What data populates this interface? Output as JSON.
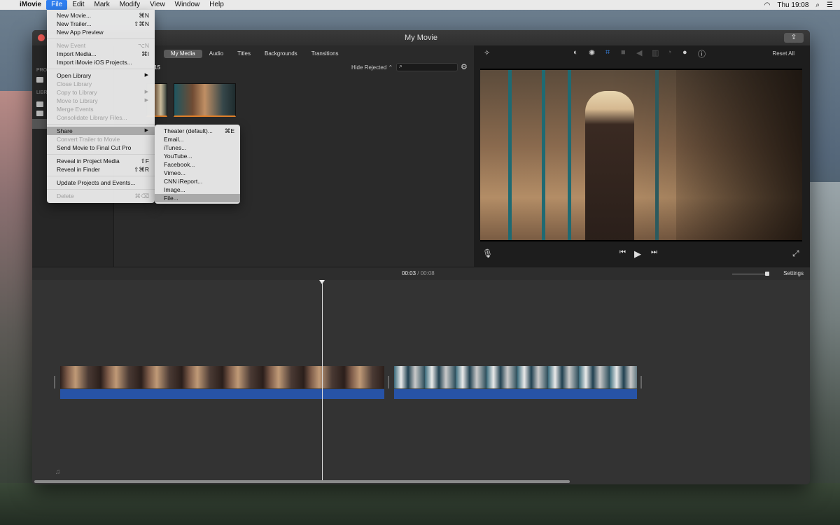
{
  "menubar": {
    "apple": "",
    "app": "iMovie",
    "items": [
      "File",
      "Edit",
      "Mark",
      "Modify",
      "View",
      "Window",
      "Help"
    ],
    "clock": "Thu 19:08"
  },
  "window": {
    "title": "My Movie",
    "share_icon": "share-icon"
  },
  "sidebar": {
    "projects_label": "PRO",
    "libraries_label": "LIBR"
  },
  "browser": {
    "tabs": [
      "My Media",
      "Audio",
      "Titles",
      "Backgrounds",
      "Transitions"
    ],
    "active_tab": "My Media",
    "count_fragment": "15",
    "hide_rejected": "Hide Rejected",
    "search_placeholder": ""
  },
  "viewer": {
    "reset_all": "Reset All",
    "tools": [
      "magic-wand-icon",
      "color-balance-icon",
      "color-correction-icon",
      "crop-icon",
      "stabilization-icon",
      "volume-icon",
      "equalizer-icon",
      "speed-icon",
      "filter-icon",
      "info-icon"
    ]
  },
  "timeline": {
    "current_time": "00:03",
    "separator": "/",
    "total_time": "00:08",
    "settings": "Settings",
    "playhead_progress": 0.38,
    "zoom_level": 0.95
  },
  "file_menu": {
    "items": [
      {
        "label": "New Movie...",
        "shortcut": "⌘N",
        "enabled": true
      },
      {
        "label": "New Trailer...",
        "shortcut": "⇧⌘N",
        "enabled": true
      },
      {
        "label": "New App Preview",
        "shortcut": "",
        "enabled": true
      },
      {
        "label": "New Event",
        "shortcut": "⌥N",
        "enabled": false
      },
      {
        "label": "Import Media...",
        "shortcut": "⌘I",
        "enabled": true
      },
      {
        "label": "Import iMovie iOS Projects...",
        "shortcut": "",
        "enabled": true
      },
      {
        "label": "Open Library",
        "shortcut": "",
        "enabled": true,
        "submenu": true
      },
      {
        "label": "Close Library",
        "shortcut": "",
        "enabled": false
      },
      {
        "label": "Copy to Library",
        "shortcut": "",
        "enabled": false,
        "submenu": true
      },
      {
        "label": "Move to Library",
        "shortcut": "",
        "enabled": false,
        "submenu": true
      },
      {
        "label": "Merge Events",
        "shortcut": "",
        "enabled": false
      },
      {
        "label": "Consolidate Library Files...",
        "shortcut": "",
        "enabled": false
      },
      {
        "label": "Share",
        "shortcut": "",
        "enabled": true,
        "submenu": true,
        "highlighted": true
      },
      {
        "label": "Convert Trailer to Movie",
        "shortcut": "",
        "enabled": false
      },
      {
        "label": "Send Movie to Final Cut Pro",
        "shortcut": "",
        "enabled": true
      },
      {
        "label": "Reveal in Project Media",
        "shortcut": "⇧F",
        "enabled": true
      },
      {
        "label": "Reveal in Finder",
        "shortcut": "⇧⌘R",
        "enabled": true
      },
      {
        "label": "Update Projects and Events...",
        "shortcut": "",
        "enabled": true
      },
      {
        "label": "Delete",
        "shortcut": "⌘⌫",
        "enabled": false
      }
    ]
  },
  "share_menu": {
    "items": [
      {
        "label": "Theater (default)...",
        "shortcut": "⌘E"
      },
      {
        "label": "Email...",
        "shortcut": ""
      },
      {
        "label": "iTunes...",
        "shortcut": ""
      },
      {
        "label": "YouTube...",
        "shortcut": ""
      },
      {
        "label": "Facebook...",
        "shortcut": ""
      },
      {
        "label": "Vimeo...",
        "shortcut": ""
      },
      {
        "label": "CNN iReport...",
        "shortcut": ""
      },
      {
        "label": "Image...",
        "shortcut": ""
      },
      {
        "label": "File...",
        "shortcut": "",
        "highlighted": true
      }
    ]
  },
  "colors": {
    "menu_highlight": "#2f7ff1",
    "audio_track": "#2753a6",
    "clip_underline": "#e0802a",
    "tool_selected": "#3a8ef4"
  }
}
